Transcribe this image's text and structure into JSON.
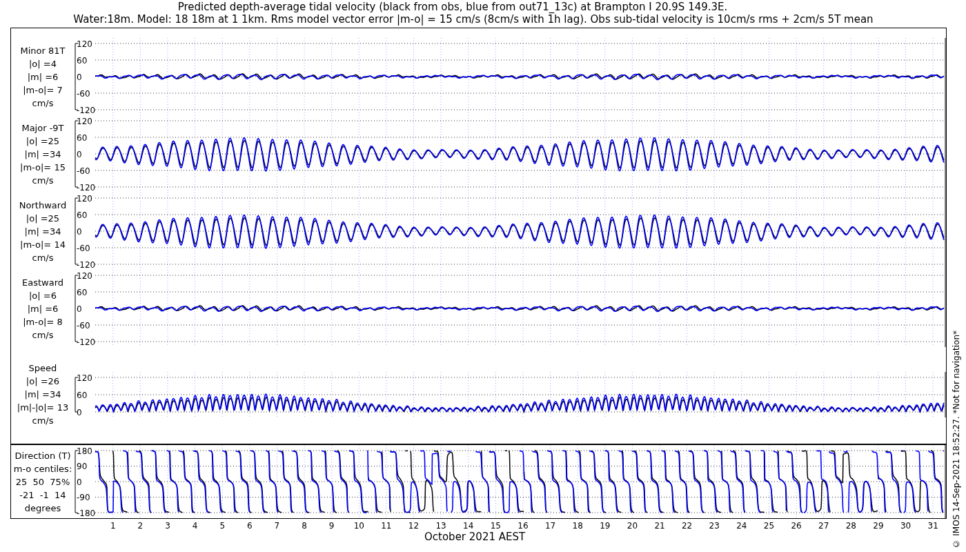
{
  "title_lines": [
    "Predicted depth-average tidal velocity (black from obs, blue from out71_13c) at Brampton I 20.9S 149.3E.",
    "Water:18m. Model: 18 18m at 1 1km. Rms model vector error |m-o| = 15 cm/s (8cm/s with 1h lag). Obs sub-tidal velocity is 10cm/s rms + 2cm/s 5T mean"
  ],
  "panels": [
    {
      "kind": "small",
      "label_lines": [
        "Minor 81T",
        "|o| =4",
        "|m| =6",
        "|m-o|= 7",
        "cm/s"
      ],
      "yticks": [
        "120",
        "60",
        "0",
        "-60",
        "-120"
      ]
    },
    {
      "kind": "large",
      "label_lines": [
        "Major -9T",
        "|o| =25",
        "|m| =34",
        "|m-o|= 15",
        "cm/s"
      ],
      "yticks": [
        "120",
        "60",
        "0",
        "-60",
        "-120"
      ]
    },
    {
      "kind": "large",
      "label_lines": [
        "Northward",
        "|o| =25",
        "|m| =34",
        "|m-o|= 14",
        "cm/s"
      ],
      "yticks": [
        "120",
        "60",
        "0",
        "-60",
        "-120"
      ]
    },
    {
      "kind": "small",
      "label_lines": [
        "Eastward",
        "|o| =6",
        "|m| =6",
        "|m-o|= 8",
        "cm/s"
      ],
      "yticks": [
        "120",
        "60",
        "0",
        "-60",
        "-120"
      ]
    },
    {
      "kind": "speed",
      "label_lines": [
        "Speed",
        "|o| =26",
        "|m| =34",
        "|m|-|o|= 13",
        "cm/s"
      ],
      "yticks": [
        "120",
        "60",
        "0"
      ]
    }
  ],
  "direction_panel": {
    "kind": "direction",
    "label_lines": [
      "Direction (T)",
      "m-o centiles:",
      "25  50  75%",
      "-21  -1  14",
      "degrees"
    ],
    "yticks": [
      "180",
      "90",
      "0",
      "-90",
      "-180"
    ]
  },
  "xticks": [
    "1",
    "2",
    "3",
    "4",
    "5",
    "6",
    "7",
    "8",
    "9",
    "10",
    "11",
    "12",
    "13",
    "14",
    "15",
    "16",
    "17",
    "18",
    "19",
    "20",
    "21",
    "22",
    "23",
    "24",
    "25",
    "26",
    "27",
    "28",
    "29",
    "30",
    "31"
  ],
  "xlabel": "October 2021 AEST",
  "side_note": "© IMOS 14-Sep-2021 18:52:27. *Not for navigation*"
}
